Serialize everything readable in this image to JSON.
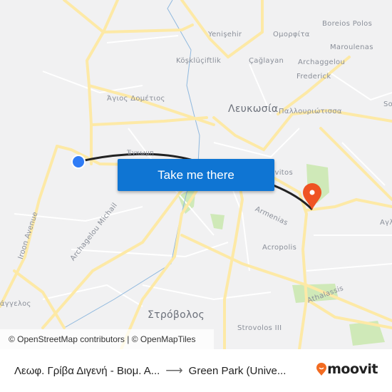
{
  "map": {
    "labels": {
      "yenisehir": "Yenişehir",
      "omorfita": "Ομορφίτα",
      "boreios_polos": "Boreios Polos",
      "maroulenas": "Maroulenas",
      "koskluciftlik": "Köşklüçiftlik",
      "caglayan": "Çağlayan",
      "archaggelou": "Archaggelou",
      "frederick": "Frederick",
      "agios_dometios": "Άγιος Δομέτιος",
      "lefkosia": "Λευκωσία",
      "pallouriotissa": "Παλλουριώτισσα",
      "so": "So",
      "engomi": "Έγκωμη",
      "lykavitos": "Lykavitos",
      "armenias": "Armenias",
      "acropolis": "Acropolis",
      "iroon_avenue": "Iroon Avenue",
      "archagelou_michail": "Archagelou Michail",
      "archangelos": "Αρχάγγελος",
      "strovolos": "Στρόβολος",
      "athalassis": "Athalassis",
      "strovolos_iii": "Strovolos III",
      "agl": "Αγλ"
    },
    "colors": {
      "road": "#fde9a6",
      "minor_road": "#ffffff",
      "park": "#cfe9b8",
      "water": "#8fb8de",
      "route": "#222222",
      "origin": "#2f7cf6",
      "destination": "#ef5323"
    }
  },
  "cta": {
    "label": "Take me there",
    "color": "#0f75d3"
  },
  "attribution": "© OpenStreetMap contributors | © OpenMapTiles",
  "footer": {
    "from": "Λεωφ. Γρίβα Διγενή - Βιομ. Α...",
    "arrow_icon": "arrow-right-icon",
    "to": "Green Park (Unive...",
    "logo": "moovit",
    "logo_color": "#f26b21"
  }
}
